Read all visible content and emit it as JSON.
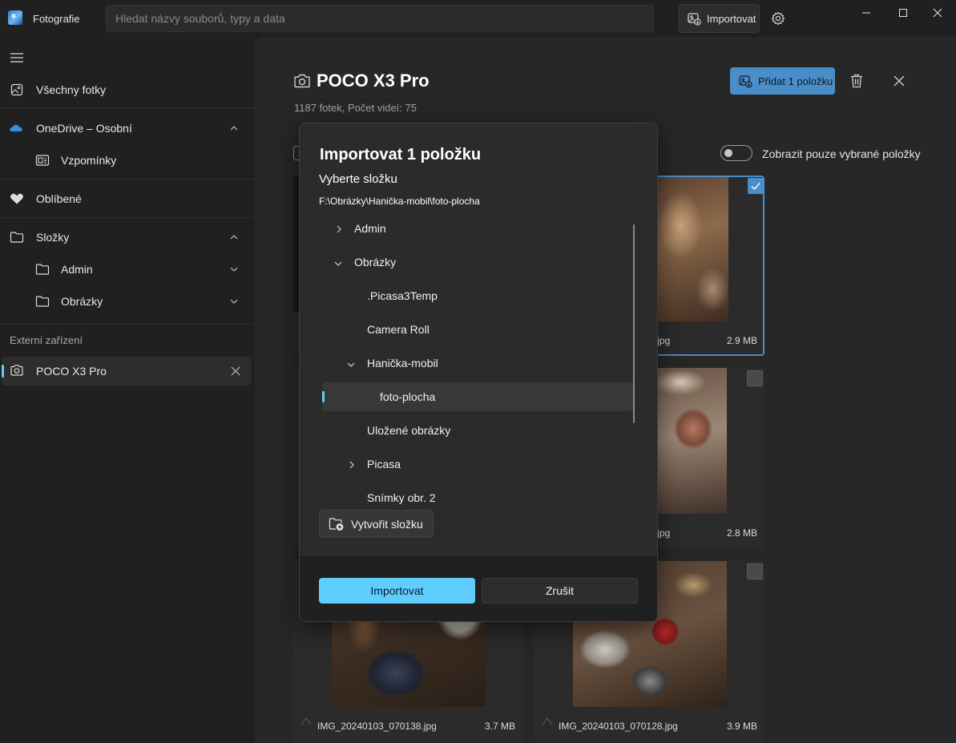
{
  "app": {
    "title": "Fotografie",
    "search_placeholder": "Hledat názvy souborů, typy a data",
    "import_label": "Importovat"
  },
  "sidebar": {
    "items": [
      {
        "label": "Všechny fotky",
        "icon": "photo-icon"
      },
      {
        "label": "OneDrive – Osobní",
        "icon": "cloud-icon"
      },
      {
        "label": "Vzpomínky",
        "icon": "memories-icon"
      },
      {
        "label": "Oblíbené",
        "icon": "heart-icon"
      },
      {
        "label": "Složky",
        "icon": "folder-icon"
      },
      {
        "label": "Admin",
        "icon": "folder-icon"
      },
      {
        "label": "Obrázky",
        "icon": "folder-icon"
      }
    ],
    "external_label": "Externí zařízení",
    "device": {
      "label": "POCO X3 Pro",
      "icon": "camera-icon"
    }
  },
  "main": {
    "title": "POCO X3 Pro",
    "subtitle": "1187 fotek, Počet videí: 75",
    "add_button": "Přidat 1 položku",
    "toggle_label": "Zobrazit pouze vybrané položky",
    "photos": [
      {
        "name": ".jpg",
        "size": "2.9 MB",
        "selected": true
      },
      {
        "name": ".jpg",
        "size": "2.8 MB",
        "selected": false
      },
      {
        "name": "IMG_20240103_070138.jpg",
        "size": "3.7 MB",
        "selected": false
      },
      {
        "name": "IMG_20240103_070128.jpg",
        "size": "3.9 MB",
        "selected": false
      }
    ]
  },
  "dialog": {
    "title": "Importovat 1 položku",
    "subtitle": "Vyberte složku",
    "path": "F:\\Obrázky\\Hanička-mobil\\foto-plocha",
    "tree": [
      {
        "label": "Admin",
        "chevron": "right"
      },
      {
        "label": "Obrázky",
        "chevron": "down"
      },
      {
        "label": ".Picasa3Temp",
        "chevron": ""
      },
      {
        "label": "Camera Roll",
        "chevron": ""
      },
      {
        "label": "Hanička-mobil",
        "chevron": "down"
      },
      {
        "label": "foto-plocha",
        "chevron": "",
        "selected": true
      },
      {
        "label": "Uložené obrázky",
        "chevron": ""
      },
      {
        "label": "Picasa",
        "chevron": "right"
      },
      {
        "label": "Snímky obr. 2",
        "chevron": ""
      }
    ],
    "new_folder": "Vytvořit složku",
    "import_button": "Importovat",
    "cancel_button": "Zrušit"
  },
  "colors": {
    "accent": "#60cdff",
    "add_button": "#4a8ec9",
    "background": "#202020",
    "dialog": "#2b2b2b"
  }
}
